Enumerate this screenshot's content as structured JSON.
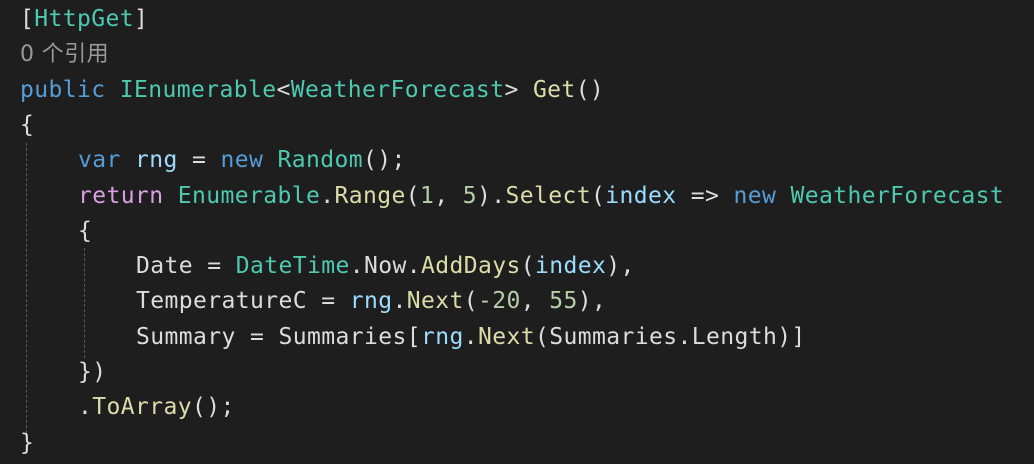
{
  "editor": {
    "theme_colors": {
      "background": "#1e1e1e",
      "keyword": "#569cd6",
      "control_keyword": "#d8a0df",
      "type": "#4ec9b0",
      "method": "#dcdcaa",
      "number": "#b5cea8",
      "variable": "#9cdcfe",
      "plain": "#dcdcdc",
      "codelens": "#999999"
    },
    "lines": [
      {
        "indent": 0,
        "tokens": [
          {
            "t": "[",
            "c": "pl"
          },
          {
            "t": "HttpGet",
            "c": "ty"
          },
          {
            "t": "]",
            "c": "pl"
          }
        ]
      },
      {
        "indent": 0,
        "codelens": true,
        "tokens": [
          {
            "t": "0 个引用",
            "c": "lens"
          }
        ]
      },
      {
        "indent": 0,
        "tokens": [
          {
            "t": "public",
            "c": "kw"
          },
          {
            "t": " ",
            "c": "pl"
          },
          {
            "t": "IEnumerable",
            "c": "ty"
          },
          {
            "t": "<",
            "c": "pl"
          },
          {
            "t": "WeatherForecast",
            "c": "ty"
          },
          {
            "t": "> ",
            "c": "pl"
          },
          {
            "t": "Get",
            "c": "mt"
          },
          {
            "t": "()",
            "c": "pl"
          }
        ]
      },
      {
        "indent": 0,
        "tokens": [
          {
            "t": "{",
            "c": "pl"
          }
        ]
      },
      {
        "indent": 1,
        "tokens": [
          {
            "t": "var",
            "c": "kw"
          },
          {
            "t": " ",
            "c": "pl"
          },
          {
            "t": "rng",
            "c": "vr"
          },
          {
            "t": " = ",
            "c": "pl"
          },
          {
            "t": "new",
            "c": "kw"
          },
          {
            "t": " ",
            "c": "pl"
          },
          {
            "t": "Random",
            "c": "ty"
          },
          {
            "t": "();",
            "c": "pl"
          }
        ]
      },
      {
        "indent": 1,
        "tokens": [
          {
            "t": "return",
            "c": "ctl"
          },
          {
            "t": " ",
            "c": "pl"
          },
          {
            "t": "Enumerable",
            "c": "ty"
          },
          {
            "t": ".",
            "c": "pl"
          },
          {
            "t": "Range",
            "c": "mt"
          },
          {
            "t": "(",
            "c": "pl"
          },
          {
            "t": "1",
            "c": "num"
          },
          {
            "t": ", ",
            "c": "pl"
          },
          {
            "t": "5",
            "c": "num"
          },
          {
            "t": ").",
            "c": "pl"
          },
          {
            "t": "Select",
            "c": "mt"
          },
          {
            "t": "(",
            "c": "pl"
          },
          {
            "t": "index",
            "c": "vr"
          },
          {
            "t": " => ",
            "c": "pl"
          },
          {
            "t": "new",
            "c": "kw"
          },
          {
            "t": " ",
            "c": "pl"
          },
          {
            "t": "WeatherForecast",
            "c": "ty"
          }
        ]
      },
      {
        "indent": 1,
        "tokens": [
          {
            "t": "{",
            "c": "pl"
          }
        ]
      },
      {
        "indent": 2,
        "tokens": [
          {
            "t": "Date",
            "c": "pl"
          },
          {
            "t": " = ",
            "c": "pl"
          },
          {
            "t": "DateTime",
            "c": "ty"
          },
          {
            "t": ".",
            "c": "pl"
          },
          {
            "t": "Now",
            "c": "pl"
          },
          {
            "t": ".",
            "c": "pl"
          },
          {
            "t": "AddDays",
            "c": "mt"
          },
          {
            "t": "(",
            "c": "pl"
          },
          {
            "t": "index",
            "c": "vr"
          },
          {
            "t": "),",
            "c": "pl"
          }
        ]
      },
      {
        "indent": 2,
        "tokens": [
          {
            "t": "TemperatureC",
            "c": "pl"
          },
          {
            "t": " = ",
            "c": "pl"
          },
          {
            "t": "rng",
            "c": "vr"
          },
          {
            "t": ".",
            "c": "pl"
          },
          {
            "t": "Next",
            "c": "mt"
          },
          {
            "t": "(",
            "c": "pl"
          },
          {
            "t": "-20",
            "c": "num"
          },
          {
            "t": ", ",
            "c": "pl"
          },
          {
            "t": "55",
            "c": "num"
          },
          {
            "t": "),",
            "c": "pl"
          }
        ]
      },
      {
        "indent": 2,
        "tokens": [
          {
            "t": "Summary",
            "c": "pl"
          },
          {
            "t": " = ",
            "c": "pl"
          },
          {
            "t": "Summaries",
            "c": "pl"
          },
          {
            "t": "[",
            "c": "pl"
          },
          {
            "t": "rng",
            "c": "vr"
          },
          {
            "t": ".",
            "c": "pl"
          },
          {
            "t": "Next",
            "c": "mt"
          },
          {
            "t": "(",
            "c": "pl"
          },
          {
            "t": "Summaries",
            "c": "pl"
          },
          {
            "t": ".",
            "c": "pl"
          },
          {
            "t": "Length",
            "c": "pl"
          },
          {
            "t": ")]",
            "c": "pl"
          }
        ]
      },
      {
        "indent": 1,
        "tokens": [
          {
            "t": "})",
            "c": "pl"
          }
        ]
      },
      {
        "indent": 1,
        "tokens": [
          {
            "t": ".",
            "c": "pl"
          },
          {
            "t": "ToArray",
            "c": "mt"
          },
          {
            "t": "();",
            "c": "pl"
          }
        ]
      },
      {
        "indent": 0,
        "tokens": [
          {
            "t": "}",
            "c": "pl"
          }
        ]
      }
    ]
  }
}
